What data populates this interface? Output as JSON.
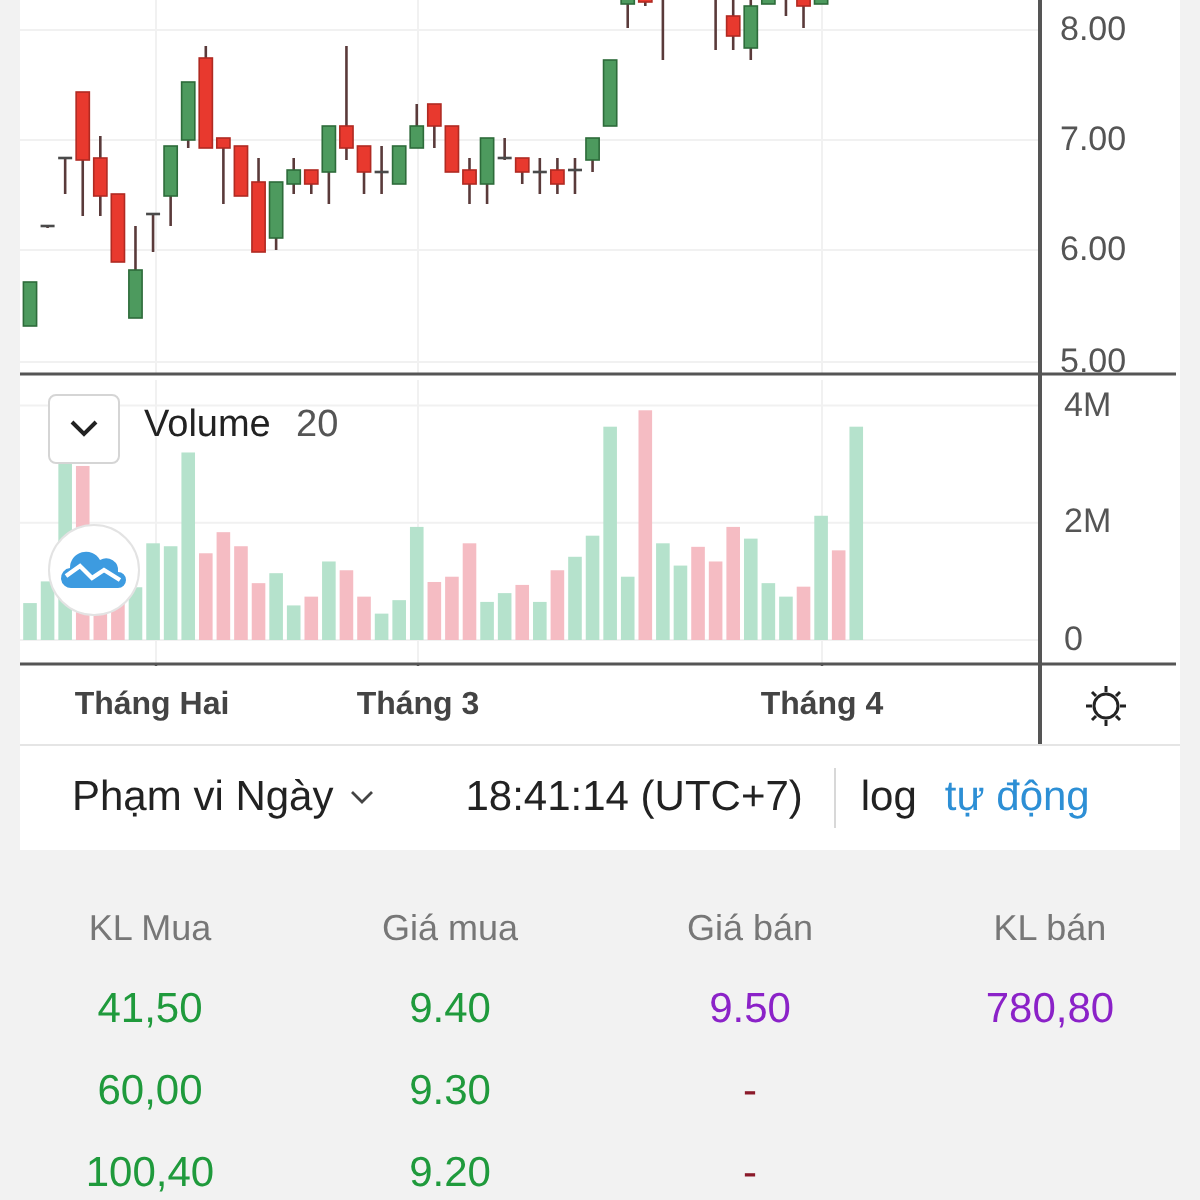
{
  "price_axis": {
    "ticks": [
      "8.00",
      "7.00",
      "6.00",
      "5.00"
    ]
  },
  "volume_pane": {
    "label": "Volume",
    "period": "20",
    "axis_labels": [
      "4M",
      "2M",
      "0"
    ]
  },
  "time_axis": {
    "labels": [
      "Tháng Hai",
      "Tháng 3",
      "Tháng 4"
    ]
  },
  "toolbar": {
    "range": "Phạm vi Ngày",
    "clock": "18:41:14 (UTC+7)",
    "scale_buttons": [
      {
        "label": "log",
        "selected": false
      },
      {
        "label": "tự động",
        "selected": true
      }
    ]
  },
  "order_book": {
    "columns": [
      "KL Mua",
      "Giá mua",
      "Giá bán",
      "KL bán"
    ],
    "rows": [
      {
        "bid_volume": "41,50",
        "bid_price": "9.40",
        "ask_price": "9.50",
        "ask_volume": "780,80",
        "ask_empty": false
      },
      {
        "bid_volume": "60,00",
        "bid_price": "9.30",
        "ask_price": "-",
        "ask_empty": true
      },
      {
        "bid_volume": "100,40",
        "bid_price": "9.20",
        "ask_price": "-",
        "ask_empty": true
      }
    ]
  }
}
